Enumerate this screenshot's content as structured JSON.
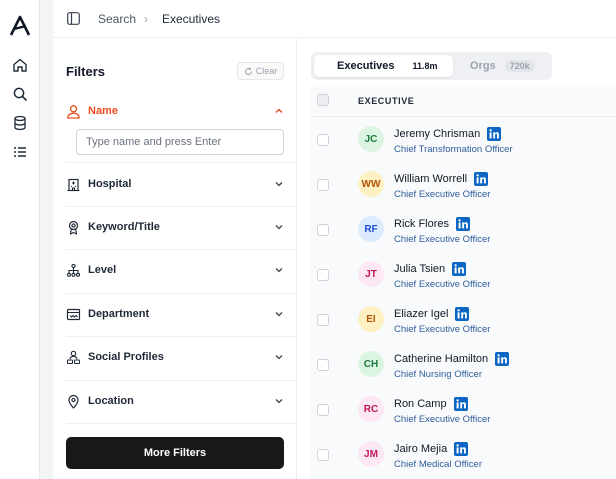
{
  "breadcrumb": {
    "root": "Search",
    "separator": "›",
    "current": "Executives"
  },
  "filters": {
    "title": "Filters",
    "clear_label": "Clear",
    "name_label": "Name",
    "name_placeholder": "Type name and press Enter",
    "items": [
      {
        "label": "Hospital",
        "icon": "hospital-icon"
      },
      {
        "label": "Keyword/Title",
        "icon": "badge-icon"
      },
      {
        "label": "Level",
        "icon": "hierarchy-icon"
      },
      {
        "label": "Department",
        "icon": "department-icon"
      },
      {
        "label": "Social Profiles",
        "icon": "people-icon"
      },
      {
        "label": "Location",
        "icon": "location-pin-icon"
      }
    ],
    "more_filters_label": "More Filters"
  },
  "tabs": [
    {
      "label": "Executives",
      "count": "11.8m",
      "active": true
    },
    {
      "label": "Orgs",
      "count": "720k",
      "active": false
    }
  ],
  "table": {
    "column_header": "EXECUTIVE",
    "rows": [
      {
        "initials": "JC",
        "name": "Jeremy Chrisman",
        "title": "Chief Transformation Officer",
        "avatar_bg": "#dcf5e3",
        "avatar_fg": "#1e7a3c"
      },
      {
        "initials": "WW",
        "name": "William Worrell",
        "title": "Chief Executive Officer",
        "avatar_bg": "#fdf0c2",
        "avatar_fg": "#b45309"
      },
      {
        "initials": "RF",
        "name": "Rick Flores",
        "title": "Chief Executive Officer",
        "avatar_bg": "#dbeafe",
        "avatar_fg": "#1d4ed8"
      },
      {
        "initials": "JT",
        "name": "Julia Tsien",
        "title": "Chief Executive Officer",
        "avatar_bg": "#fce7f3",
        "avatar_fg": "#be185d"
      },
      {
        "initials": "EI",
        "name": "Eliazer Igel",
        "title": "Chief Executive Officer",
        "avatar_bg": "#fdf0c2",
        "avatar_fg": "#b45309"
      },
      {
        "initials": "CH",
        "name": "Catherine Hamilton",
        "title": "Chief Nursing Officer",
        "avatar_bg": "#dcf5e3",
        "avatar_fg": "#1e7a3c"
      },
      {
        "initials": "RC",
        "name": "Ron Camp",
        "title": "Chief Executive Officer",
        "avatar_bg": "#fce7f3",
        "avatar_fg": "#be185d"
      },
      {
        "initials": "JM",
        "name": "Jairo Mejia",
        "title": "Chief Medical Officer",
        "avatar_bg": "#fce7f3",
        "avatar_fg": "#be185d"
      }
    ]
  },
  "colors": {
    "accent": "#ea4d1f",
    "linkedin": "#0a66c2",
    "title_link": "#2f5d9c",
    "primary_button": "#18181b"
  }
}
